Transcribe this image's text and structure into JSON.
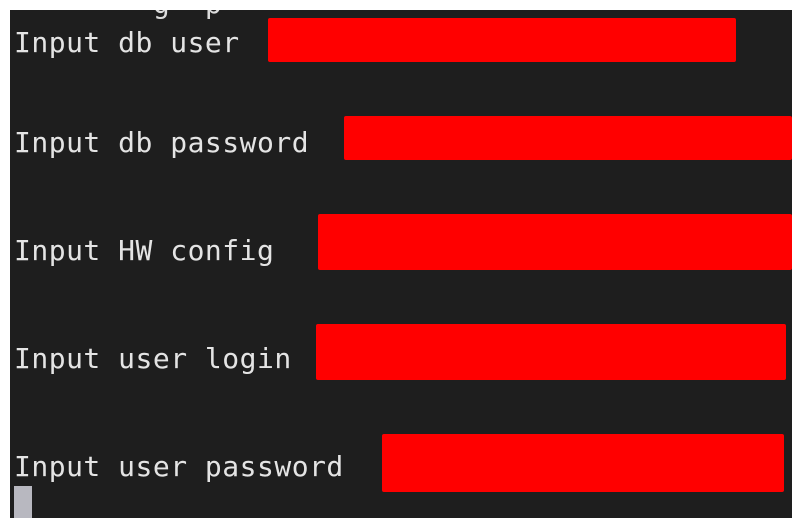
{
  "terminal": {
    "background": "#1e1e1e",
    "text_color": "#e4e4e4",
    "redaction_color": "#ff0000",
    "cutoff_text": "        g  p",
    "lines": [
      {
        "prompt": "Input db user"
      },
      {
        "prompt": "Input db password"
      },
      {
        "prompt": "Input HW config "
      },
      {
        "prompt": "Input user login"
      },
      {
        "prompt": "Input user password"
      }
    ],
    "cursor": "block-cursor"
  }
}
